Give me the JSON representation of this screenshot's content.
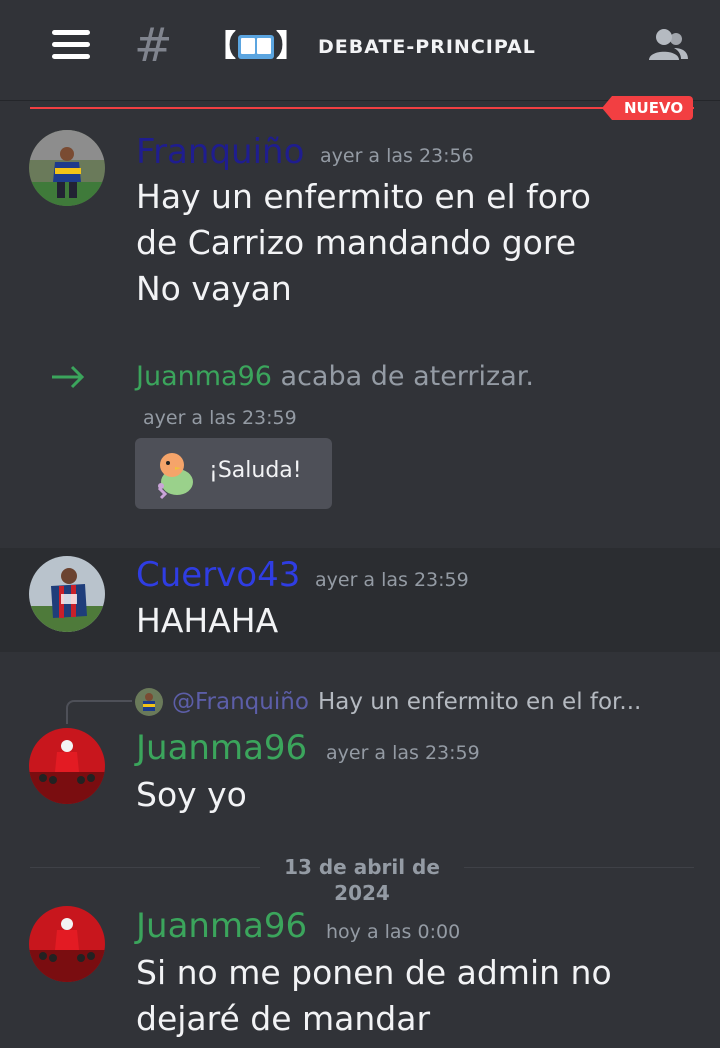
{
  "header": {
    "channel_name": "DEBATE-PRINCIPAL",
    "bracket_left": "【",
    "bracket_right": "】",
    "hash_symbol": "#"
  },
  "new_marker": {
    "label": "NUEVO"
  },
  "messages": [
    {
      "author": "Franquiño",
      "author_color": "#1f1d8f",
      "timestamp": "ayer a las 23:56",
      "lines": [
        "Hay un enfermito en el foro",
        "de Carrizo mandando gore",
        "No vayan"
      ]
    },
    {
      "author": "Cuervo43",
      "author_color": "#2f3de3",
      "timestamp": "ayer a las 23:59",
      "lines": [
        "HAHAHA"
      ]
    },
    {
      "author": "Juanma96",
      "author_color": "#3ba55c",
      "timestamp": "ayer a las 23:59",
      "lines": [
        "Soy yo"
      ]
    },
    {
      "author": "Juanma96",
      "author_color": "#3ba55c",
      "timestamp": "hoy a las 0:00",
      "lines": [
        "Si no me ponen de admin no",
        "dejaré de mandar"
      ]
    }
  ],
  "system_join": {
    "username": "Juanma96",
    "text": "acaba de aterrizar.",
    "timestamp": "ayer a las 23:59",
    "wave_button": "¡Saluda!"
  },
  "reply": {
    "mention": "@Franquiño",
    "snippet": "Hay un enfermito en el for..."
  },
  "date_divider": "13 de abril de 2024",
  "colors": {
    "background": "#313338",
    "accent_red": "#f23f42",
    "username_green": "#3ba55c"
  },
  "icons": [
    "menu-icon",
    "hash-icon",
    "book-icon",
    "members-icon",
    "join-arrow-icon",
    "wave-sticker-icon"
  ]
}
